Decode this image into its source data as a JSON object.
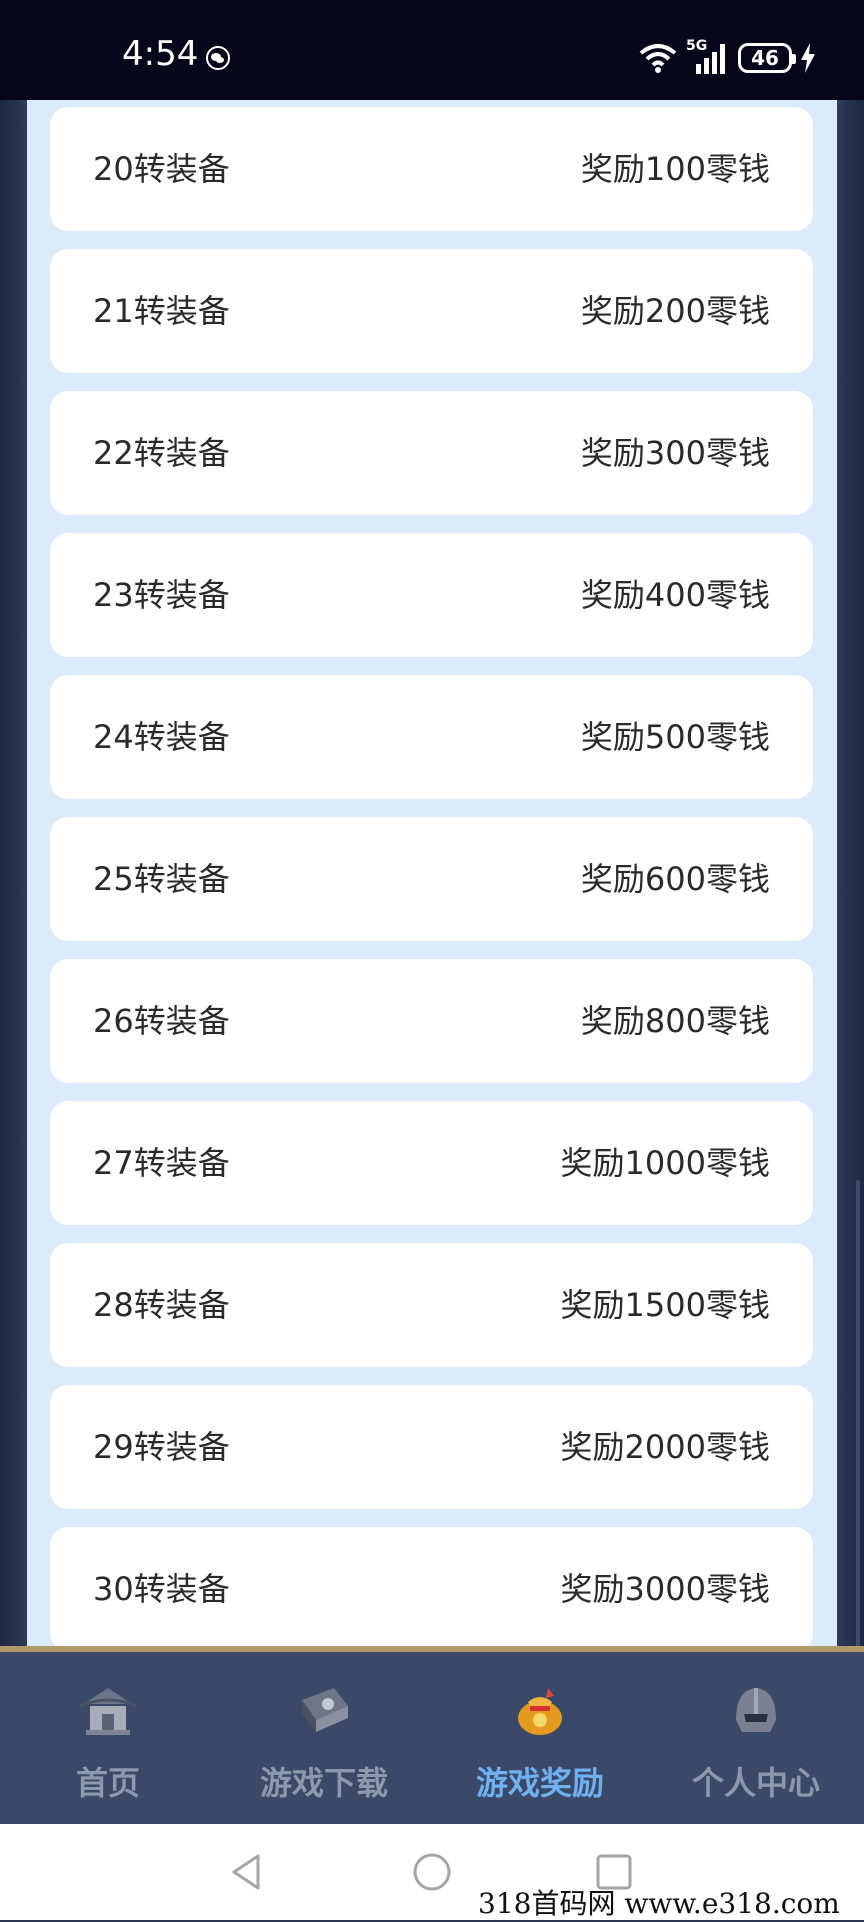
{
  "status_bar": {
    "time": "4:54",
    "network_label": "5G",
    "battery_level": "46",
    "icons": [
      "wechat-icon",
      "wifi-icon",
      "signal-icon",
      "battery-icon",
      "charging-icon"
    ]
  },
  "rewards": [
    {
      "name": "20转装备",
      "reward": "奖励100零钱"
    },
    {
      "name": "21转装备",
      "reward": "奖励200零钱"
    },
    {
      "name": "22转装备",
      "reward": "奖励300零钱"
    },
    {
      "name": "23转装备",
      "reward": "奖励400零钱"
    },
    {
      "name": "24转装备",
      "reward": "奖励500零钱"
    },
    {
      "name": "25转装备",
      "reward": "奖励600零钱"
    },
    {
      "name": "26转装备",
      "reward": "奖励800零钱"
    },
    {
      "name": "27转装备",
      "reward": "奖励1000零钱"
    },
    {
      "name": "28转装备",
      "reward": "奖励1500零钱"
    },
    {
      "name": "29转装备",
      "reward": "奖励2000零钱"
    },
    {
      "name": "30转装备",
      "reward": "奖励3000零钱"
    }
  ],
  "bottom_nav": {
    "items": [
      {
        "label": "首页",
        "icon": "home-pavilion-icon",
        "active": false
      },
      {
        "label": "游戏下载",
        "icon": "game-download-icon",
        "active": false
      },
      {
        "label": "游戏奖励",
        "icon": "money-bag-icon",
        "active": true
      },
      {
        "label": "个人中心",
        "icon": "helmet-icon",
        "active": false
      }
    ],
    "active_color": "#6fb0f0",
    "inactive_color": "#8e98ad"
  },
  "system_nav": {
    "icons": [
      "back-icon",
      "home-icon",
      "recents-icon"
    ]
  },
  "watermark": "318首码网  www.e318.com"
}
